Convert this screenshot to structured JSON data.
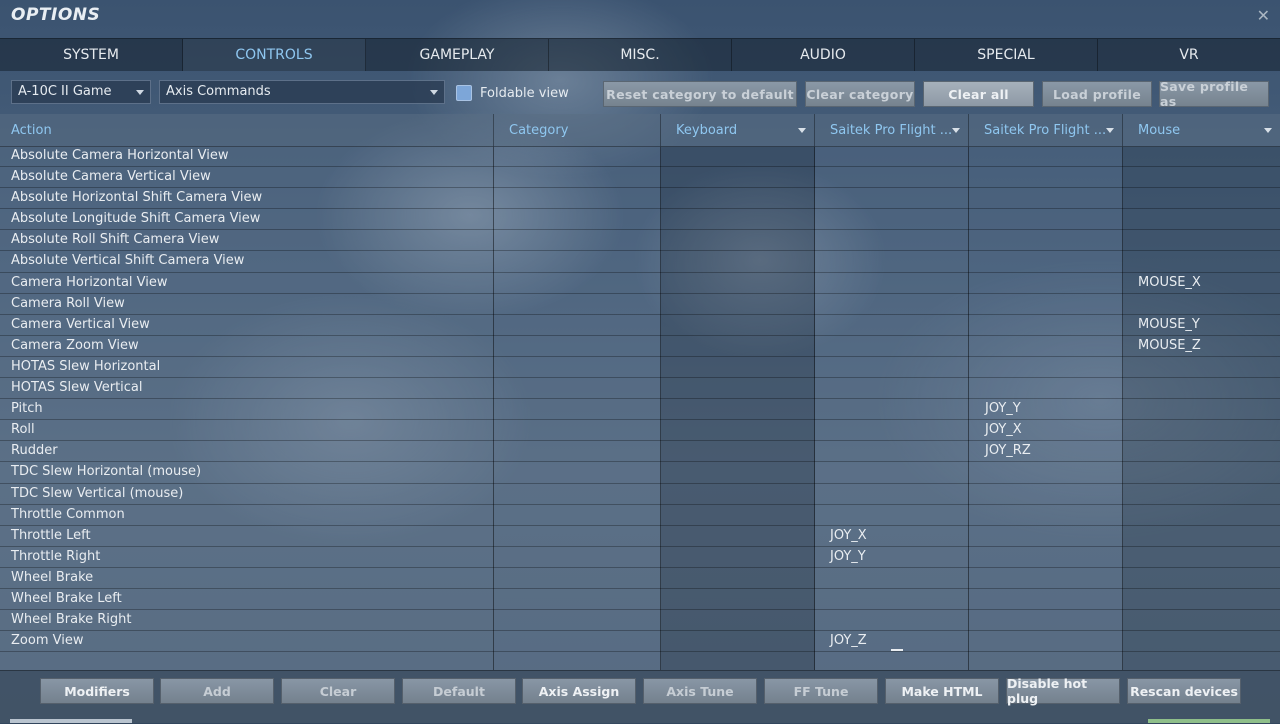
{
  "window": {
    "title": "OPTIONS",
    "close_glyph": "✕"
  },
  "tabs": [
    {
      "label": "SYSTEM",
      "active": false
    },
    {
      "label": "CONTROLS",
      "active": true
    },
    {
      "label": "GAMEPLAY",
      "active": false
    },
    {
      "label": "MISC.",
      "active": false
    },
    {
      "label": "AUDIO",
      "active": false
    },
    {
      "label": "SPECIAL",
      "active": false
    },
    {
      "label": "VR",
      "active": false
    }
  ],
  "toolbar": {
    "aircraft_select": "A-10C II Game",
    "category_select": "Axis Commands",
    "foldable_view": {
      "label": "Foldable view",
      "checked": true
    },
    "buttons": {
      "reset_category": "Reset category to default",
      "clear_category": "Clear category",
      "clear_all": "Clear all",
      "load_profile": "Load profile",
      "save_profile_as": "Save profile as"
    }
  },
  "table": {
    "columns": {
      "action": "Action",
      "category": "Category",
      "keyboard": "Keyboard",
      "device1": "Saitek Pro Flight ...",
      "device2": "Saitek Pro Flight ...",
      "mouse": "Mouse"
    },
    "rows": [
      {
        "action": "Absolute Camera Horizontal View",
        "sp1": "",
        "sp2": "",
        "mouse": ""
      },
      {
        "action": "Absolute Camera Vertical View",
        "sp1": "",
        "sp2": "",
        "mouse": ""
      },
      {
        "action": "Absolute Horizontal Shift Camera View",
        "sp1": "",
        "sp2": "",
        "mouse": ""
      },
      {
        "action": "Absolute Longitude Shift Camera View",
        "sp1": "",
        "sp2": "",
        "mouse": ""
      },
      {
        "action": "Absolute Roll Shift Camera View",
        "sp1": "",
        "sp2": "",
        "mouse": ""
      },
      {
        "action": "Absolute Vertical Shift Camera View",
        "sp1": "",
        "sp2": "",
        "mouse": ""
      },
      {
        "action": "Camera Horizontal View",
        "sp1": "",
        "sp2": "",
        "mouse": "MOUSE_X"
      },
      {
        "action": "Camera Roll View",
        "sp1": "",
        "sp2": "",
        "mouse": ""
      },
      {
        "action": "Camera Vertical View",
        "sp1": "",
        "sp2": "",
        "mouse": "MOUSE_Y"
      },
      {
        "action": "Camera Zoom View",
        "sp1": "",
        "sp2": "",
        "mouse": "MOUSE_Z"
      },
      {
        "action": "HOTAS Slew Horizontal",
        "sp1": "",
        "sp2": "",
        "mouse": ""
      },
      {
        "action": "HOTAS Slew Vertical",
        "sp1": "",
        "sp2": "",
        "mouse": ""
      },
      {
        "action": "Pitch",
        "sp1": "",
        "sp2": "JOY_Y",
        "mouse": ""
      },
      {
        "action": "Roll",
        "sp1": "",
        "sp2": "JOY_X",
        "mouse": ""
      },
      {
        "action": "Rudder",
        "sp1": "",
        "sp2": "JOY_RZ",
        "mouse": ""
      },
      {
        "action": "TDC Slew Horizontal (mouse)",
        "sp1": "",
        "sp2": "",
        "mouse": ""
      },
      {
        "action": "TDC Slew Vertical (mouse)",
        "sp1": "",
        "sp2": "",
        "mouse": ""
      },
      {
        "action": "Throttle Common",
        "sp1": "",
        "sp2": "",
        "mouse": ""
      },
      {
        "action": "Throttle Left",
        "sp1": "JOY_X",
        "sp2": "",
        "mouse": ""
      },
      {
        "action": "Throttle Right",
        "sp1": "JOY_Y",
        "sp2": "",
        "mouse": ""
      },
      {
        "action": "Wheel Brake",
        "sp1": "",
        "sp2": "",
        "mouse": ""
      },
      {
        "action": "Wheel Brake Left",
        "sp1": "",
        "sp2": "",
        "mouse": ""
      },
      {
        "action": "Wheel Brake Right",
        "sp1": "",
        "sp2": "",
        "mouse": ""
      },
      {
        "action": "Zoom View",
        "sp1": "JOY_Z",
        "sp2": "",
        "mouse": ""
      }
    ]
  },
  "bottom_buttons": {
    "modifiers": "Modifiers",
    "add": "Add",
    "clear": "Clear",
    "default": "Default",
    "axis_assign": "Axis Assign",
    "axis_tune": "Axis Tune",
    "ff_tune": "FF Tune",
    "make_html": "Make HTML",
    "disable_hot_plug": "Disable hot plug",
    "rescan_devices": "Rescan devices"
  }
}
